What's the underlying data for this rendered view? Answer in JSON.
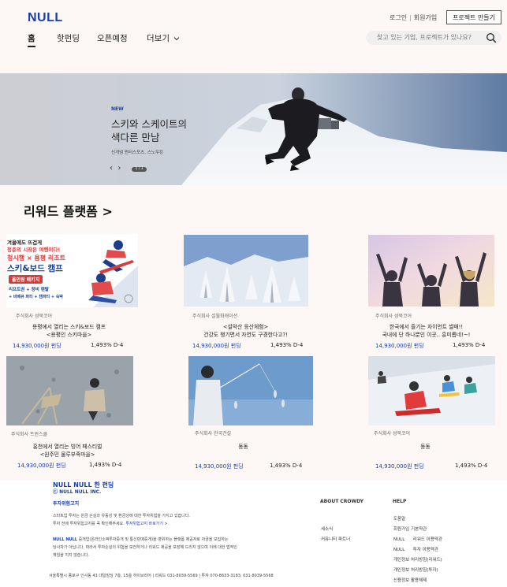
{
  "header": {
    "logo": "NULL",
    "login": "로그인",
    "signup": "회원가입",
    "create_project": "프로젝트 만들기",
    "nav": [
      {
        "label": "홈"
      },
      {
        "label": "핫펀딩"
      },
      {
        "label": "오픈예정"
      },
      {
        "label": "더보기"
      }
    ],
    "search_placeholder": "찾고 있는 기업, 프로젝트가 있나요?"
  },
  "banner": {
    "badge": "NEW",
    "title_line1": "스키와 스케이트의",
    "title_line2": "색다른 만남",
    "subtitle": "신개념 윈터스포츠, 스노우킹",
    "page_indicator": "1 / 3"
  },
  "section": {
    "title": "리워드 플랫폼  >"
  },
  "cards": [
    {
      "company": "주식회사 성북코어",
      "title1": "용평에서 열리는 스키&보드 캠프",
      "title2": "<용평인 스키마을>",
      "amount": "14,930,000원 펀딩",
      "percent": "1,493% D-4"
    },
    {
      "company": "주식회사 설월화캐이션",
      "title1": "<설악산 등산체험>",
      "title2": "건강도 챙기면서 자연도 구경한다고?!",
      "amount": "14,930,000원 펀딩",
      "percent": "1,493% D-4"
    },
    {
      "company": "주식회사 성북코어",
      "title1": "한국에서 즐기는 자이언트 썰매!!",
      "title2": "국내에 단 하나뿐인 이곳.. 흥미롭네!~!",
      "amount": "14,930,000원 펀딩",
      "percent": "1,493% D-4"
    },
    {
      "company": "주식회사 트윈스쿨",
      "title1": "홍천에서 열리는 빙어 페스티벌",
      "title2": "<원주민 물루부족마을>",
      "amount": "14,930,000원 펀딩",
      "percent": "1,493% D-4"
    },
    {
      "company": "주식회사 한국건설",
      "title1": "동동",
      "title2": "",
      "amount": "14,930,000원 펀딩",
      "percent": "1,493% D-4"
    },
    {
      "company": "주식회사 성북코어",
      "title1": "동동",
      "title2": "",
      "amount": "14,930,000원 펀딩",
      "percent": "1,493% D-4"
    }
  ],
  "card1_poster": {
    "line1": "겨울에도 뜨겁게",
    "line2": "청춘의 시작은 여행이다!",
    "line3": "청시행 × 용평 리조트",
    "line4": "스키&보드 캠프",
    "badge": "올인원 패키지",
    "line5": "리프트권 + 장비 렌탈",
    "line6": "+ 바베큐 파티 + 캠파티 + 숙박"
  },
  "footer": {
    "brand": "NULL NULL 한 펀딩",
    "brand_sub": "ⓒ NULL NULL INC.",
    "risk_title": "투자위험고지",
    "risk_line1": "스타트업 투자는 원금 손실과 유동성 및 환금성에 대한 투자위험을 가지고 있습니다.",
    "risk_line2": "투자 전에 투자위험고지를 꼭 확인해주세요.",
    "risk_link": "투자위험고지 바로가기  >",
    "desc_brand": "NULL NULL",
    "desc_line1": " 중개업(온라인소액투자중개 및 통신판매중개)을 영위하는 플랫폼 제공자로 자금을 모집하는",
    "desc_line2": "당사자가 아닙니다. 따라서 투자손실의 위험을 보전하거나 리워드 제공을 보장해 드리지 않으며 이에 대한 법적인",
    "desc_line3": "책임을 지지 않습니다.",
    "address": "서울특별시 종로구 인사동 43 대일빌딩 7층, 15층 하이브리어 | 리워드 031-8039-5569 | 투자 070-8633-3183, 031-8039-5568",
    "about_head": "ABOUT CROWDY",
    "about_items": [
      "세소식",
      "커뮤니티 파트너"
    ],
    "help_head": "HELP",
    "help_items": [
      "도움말",
      "회원가입 기본약관",
      "NULL      리워드 이용약관",
      "NULL      투자 이용약관",
      "개인정보 처리방침(리워드)",
      "개인정보 처리방침(투자)",
      "신용정보 활용체제"
    ]
  }
}
